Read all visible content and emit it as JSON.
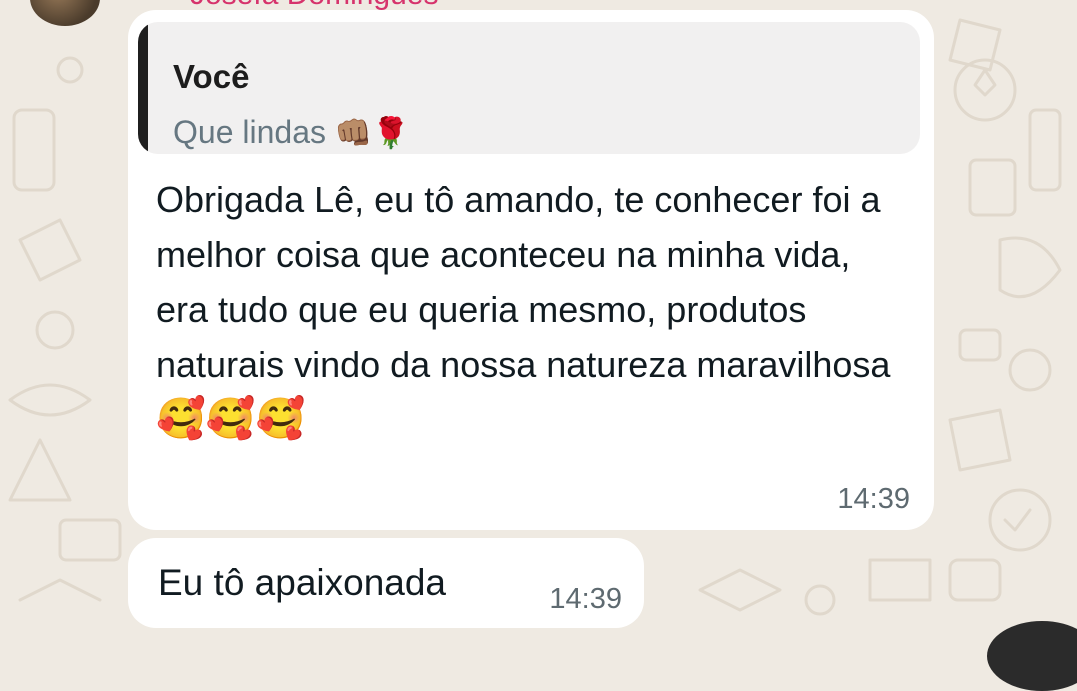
{
  "chat": {
    "sender_name": "Josefa Domingues",
    "avatar_icon": "contact-avatar",
    "messages": [
      {
        "quote": {
          "author": "Você",
          "text": "Que lindas",
          "emojis": "👊🏽🌹"
        },
        "text": "Obrigada Lê, eu tô amando, te conhecer foi a melhor coisa que aconteceu na minha vida, era tudo que eu queria mesmo, produtos naturais vindo da nossa natureza maravilhosa",
        "emojis": "🥰🥰🥰",
        "time": "14:39"
      },
      {
        "text": "Eu tô apaixonada",
        "time": "14:39"
      }
    ]
  },
  "colors": {
    "background": "#efeae2",
    "bubble": "#ffffff",
    "quote_background": "#f1f0f0",
    "sender_name": "#d6336c"
  }
}
